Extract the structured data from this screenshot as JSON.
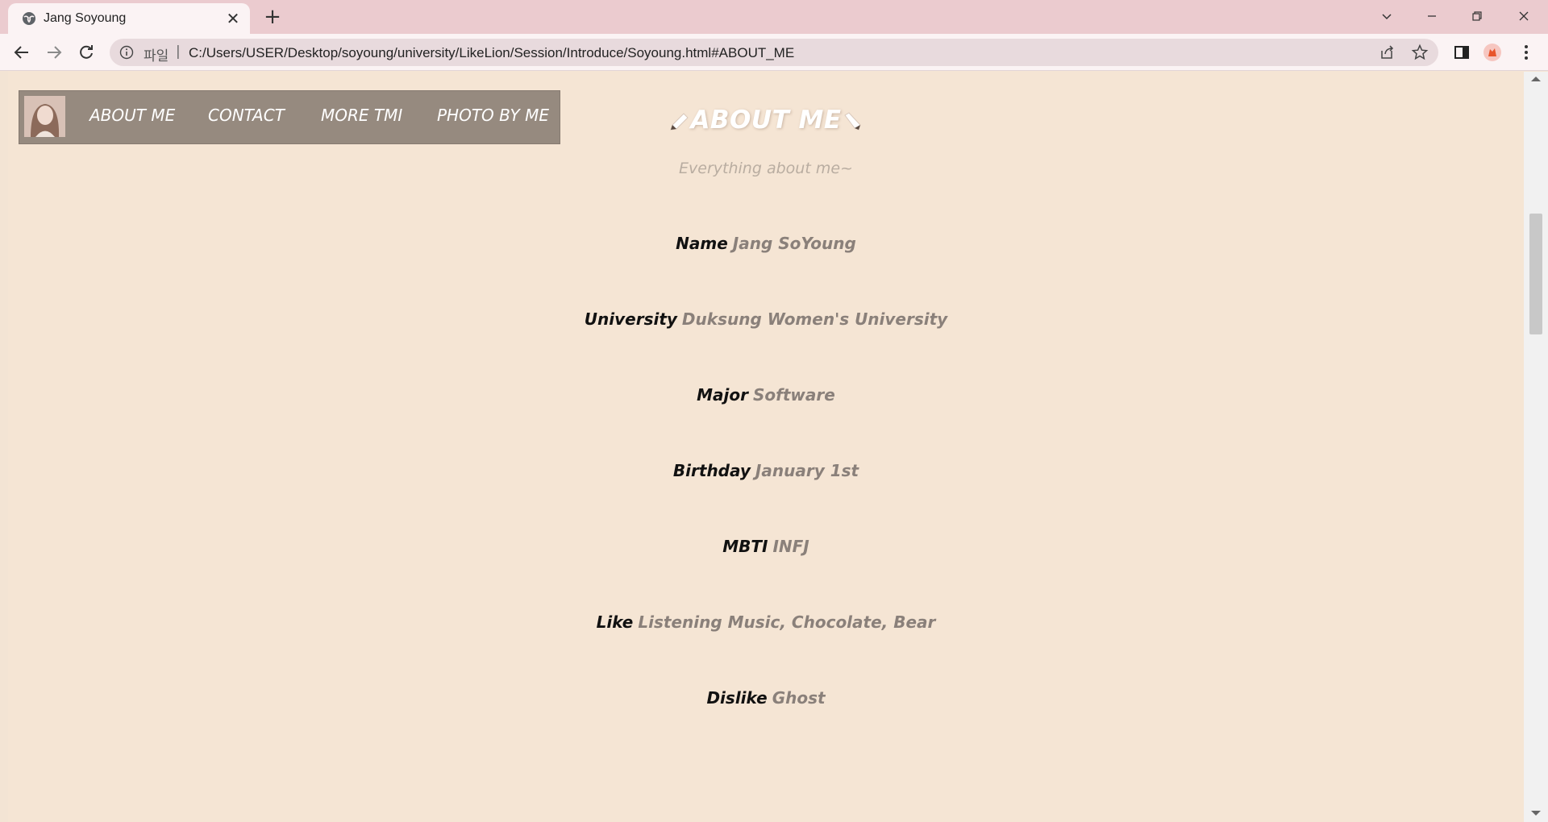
{
  "browser": {
    "tab_title": "Jang Soyoung",
    "scheme_label": "파일",
    "separator": "|",
    "url": "C:/Users/USER/Desktop/soyoung/university/LikeLion/Session/Introduce/Soyoung.html#ABOUT_ME"
  },
  "page": {
    "nav": {
      "items": [
        {
          "label": "ABOUT ME"
        },
        {
          "label": "CONTACT"
        },
        {
          "label": "MORE TMI"
        },
        {
          "label": "PHOTO BY ME"
        }
      ]
    },
    "about": {
      "heading": "ABOUT ME",
      "subtitle": "Everything about me~",
      "rows": [
        {
          "label": "Name",
          "value": "Jang SoYoung"
        },
        {
          "label": "University",
          "value": "Duksung Women's University"
        },
        {
          "label": "Major",
          "value": "Software"
        },
        {
          "label": "Birthday",
          "value": "January 1st"
        },
        {
          "label": "MBTI",
          "value": "INFJ"
        },
        {
          "label": "Like",
          "value": "Listening Music, Chocolate, Bear"
        },
        {
          "label": "Dislike",
          "value": "Ghost"
        }
      ]
    }
  },
  "colors": {
    "titlebar": "#ebcbcf",
    "page_bg": "#f5e5d4",
    "nav_bg": "#968a7f",
    "label": "#111111",
    "value": "#8a807a"
  },
  "icons": [
    "globe-icon",
    "close-icon",
    "plus-icon",
    "chevron-down-icon",
    "minimize-icon",
    "restore-icon",
    "back-icon",
    "forward-icon",
    "reload-icon",
    "info-icon",
    "share-icon",
    "star-icon",
    "sidepanel-icon",
    "extension-icon",
    "menu-icon",
    "pencil-icon"
  ]
}
